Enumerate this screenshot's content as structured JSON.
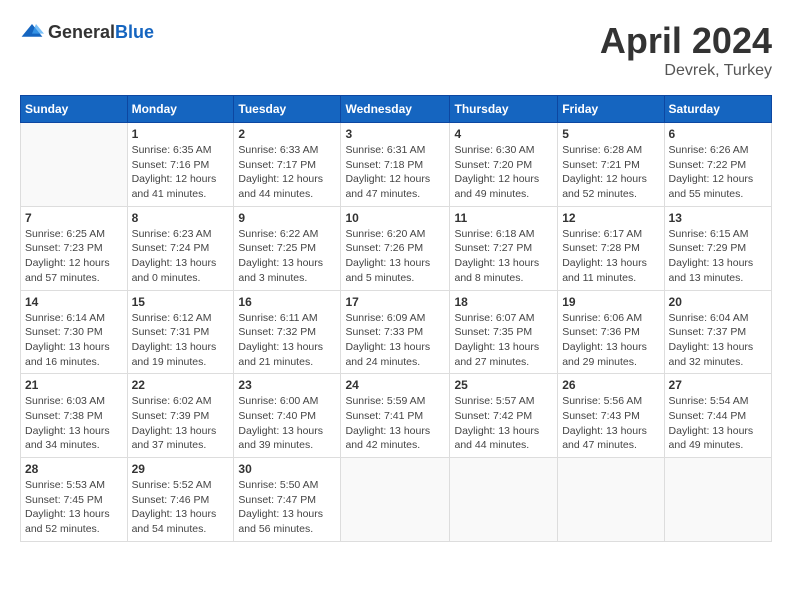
{
  "header": {
    "logo_general": "General",
    "logo_blue": "Blue",
    "title": "April 2024",
    "location": "Devrek, Turkey"
  },
  "days_of_week": [
    "Sunday",
    "Monday",
    "Tuesday",
    "Wednesday",
    "Thursday",
    "Friday",
    "Saturday"
  ],
  "weeks": [
    [
      {
        "day": "",
        "info": ""
      },
      {
        "day": "1",
        "info": "Sunrise: 6:35 AM\nSunset: 7:16 PM\nDaylight: 12 hours\nand 41 minutes."
      },
      {
        "day": "2",
        "info": "Sunrise: 6:33 AM\nSunset: 7:17 PM\nDaylight: 12 hours\nand 44 minutes."
      },
      {
        "day": "3",
        "info": "Sunrise: 6:31 AM\nSunset: 7:18 PM\nDaylight: 12 hours\nand 47 minutes."
      },
      {
        "day": "4",
        "info": "Sunrise: 6:30 AM\nSunset: 7:20 PM\nDaylight: 12 hours\nand 49 minutes."
      },
      {
        "day": "5",
        "info": "Sunrise: 6:28 AM\nSunset: 7:21 PM\nDaylight: 12 hours\nand 52 minutes."
      },
      {
        "day": "6",
        "info": "Sunrise: 6:26 AM\nSunset: 7:22 PM\nDaylight: 12 hours\nand 55 minutes."
      }
    ],
    [
      {
        "day": "7",
        "info": "Sunrise: 6:25 AM\nSunset: 7:23 PM\nDaylight: 12 hours\nand 57 minutes."
      },
      {
        "day": "8",
        "info": "Sunrise: 6:23 AM\nSunset: 7:24 PM\nDaylight: 13 hours\nand 0 minutes."
      },
      {
        "day": "9",
        "info": "Sunrise: 6:22 AM\nSunset: 7:25 PM\nDaylight: 13 hours\nand 3 minutes."
      },
      {
        "day": "10",
        "info": "Sunrise: 6:20 AM\nSunset: 7:26 PM\nDaylight: 13 hours\nand 5 minutes."
      },
      {
        "day": "11",
        "info": "Sunrise: 6:18 AM\nSunset: 7:27 PM\nDaylight: 13 hours\nand 8 minutes."
      },
      {
        "day": "12",
        "info": "Sunrise: 6:17 AM\nSunset: 7:28 PM\nDaylight: 13 hours\nand 11 minutes."
      },
      {
        "day": "13",
        "info": "Sunrise: 6:15 AM\nSunset: 7:29 PM\nDaylight: 13 hours\nand 13 minutes."
      }
    ],
    [
      {
        "day": "14",
        "info": "Sunrise: 6:14 AM\nSunset: 7:30 PM\nDaylight: 13 hours\nand 16 minutes."
      },
      {
        "day": "15",
        "info": "Sunrise: 6:12 AM\nSunset: 7:31 PM\nDaylight: 13 hours\nand 19 minutes."
      },
      {
        "day": "16",
        "info": "Sunrise: 6:11 AM\nSunset: 7:32 PM\nDaylight: 13 hours\nand 21 minutes."
      },
      {
        "day": "17",
        "info": "Sunrise: 6:09 AM\nSunset: 7:33 PM\nDaylight: 13 hours\nand 24 minutes."
      },
      {
        "day": "18",
        "info": "Sunrise: 6:07 AM\nSunset: 7:35 PM\nDaylight: 13 hours\nand 27 minutes."
      },
      {
        "day": "19",
        "info": "Sunrise: 6:06 AM\nSunset: 7:36 PM\nDaylight: 13 hours\nand 29 minutes."
      },
      {
        "day": "20",
        "info": "Sunrise: 6:04 AM\nSunset: 7:37 PM\nDaylight: 13 hours\nand 32 minutes."
      }
    ],
    [
      {
        "day": "21",
        "info": "Sunrise: 6:03 AM\nSunset: 7:38 PM\nDaylight: 13 hours\nand 34 minutes."
      },
      {
        "day": "22",
        "info": "Sunrise: 6:02 AM\nSunset: 7:39 PM\nDaylight: 13 hours\nand 37 minutes."
      },
      {
        "day": "23",
        "info": "Sunrise: 6:00 AM\nSunset: 7:40 PM\nDaylight: 13 hours\nand 39 minutes."
      },
      {
        "day": "24",
        "info": "Sunrise: 5:59 AM\nSunset: 7:41 PM\nDaylight: 13 hours\nand 42 minutes."
      },
      {
        "day": "25",
        "info": "Sunrise: 5:57 AM\nSunset: 7:42 PM\nDaylight: 13 hours\nand 44 minutes."
      },
      {
        "day": "26",
        "info": "Sunrise: 5:56 AM\nSunset: 7:43 PM\nDaylight: 13 hours\nand 47 minutes."
      },
      {
        "day": "27",
        "info": "Sunrise: 5:54 AM\nSunset: 7:44 PM\nDaylight: 13 hours\nand 49 minutes."
      }
    ],
    [
      {
        "day": "28",
        "info": "Sunrise: 5:53 AM\nSunset: 7:45 PM\nDaylight: 13 hours\nand 52 minutes."
      },
      {
        "day": "29",
        "info": "Sunrise: 5:52 AM\nSunset: 7:46 PM\nDaylight: 13 hours\nand 54 minutes."
      },
      {
        "day": "30",
        "info": "Sunrise: 5:50 AM\nSunset: 7:47 PM\nDaylight: 13 hours\nand 56 minutes."
      },
      {
        "day": "",
        "info": ""
      },
      {
        "day": "",
        "info": ""
      },
      {
        "day": "",
        "info": ""
      },
      {
        "day": "",
        "info": ""
      }
    ]
  ]
}
